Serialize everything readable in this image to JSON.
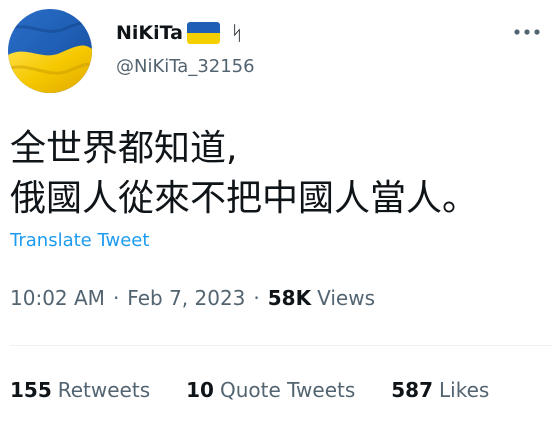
{
  "author": {
    "display_name": "NiKiTa",
    "name_emoji": "ukraine-flag-icon",
    "name_symbol": "ᛋ",
    "handle": "@NiKiTa_32156",
    "avatar": "ukraine-flag-avatar"
  },
  "tweet": {
    "text_line1": "全世界都知道,",
    "text_line2": "俄國人從來不把中國人當人。",
    "translate_label": "Translate Tweet"
  },
  "meta": {
    "time": "10:02 AM",
    "sep1": "·",
    "date": "Feb 7, 2023",
    "sep2": "·",
    "views_count": "58K",
    "views_label": "Views"
  },
  "stats": {
    "retweets_count": "155",
    "retweets_label": "Retweets",
    "quotes_count": "10",
    "quotes_label": "Quote Tweets",
    "likes_count": "587",
    "likes_label": "Likes"
  },
  "colors": {
    "flag_blue": "#1f5fb5",
    "flag_yellow": "#f5d000",
    "link_blue": "#1d9bf0",
    "secondary_text": "#536471",
    "primary_text": "#0f1419"
  },
  "icons": {
    "more": "more-horizontal-icon"
  }
}
